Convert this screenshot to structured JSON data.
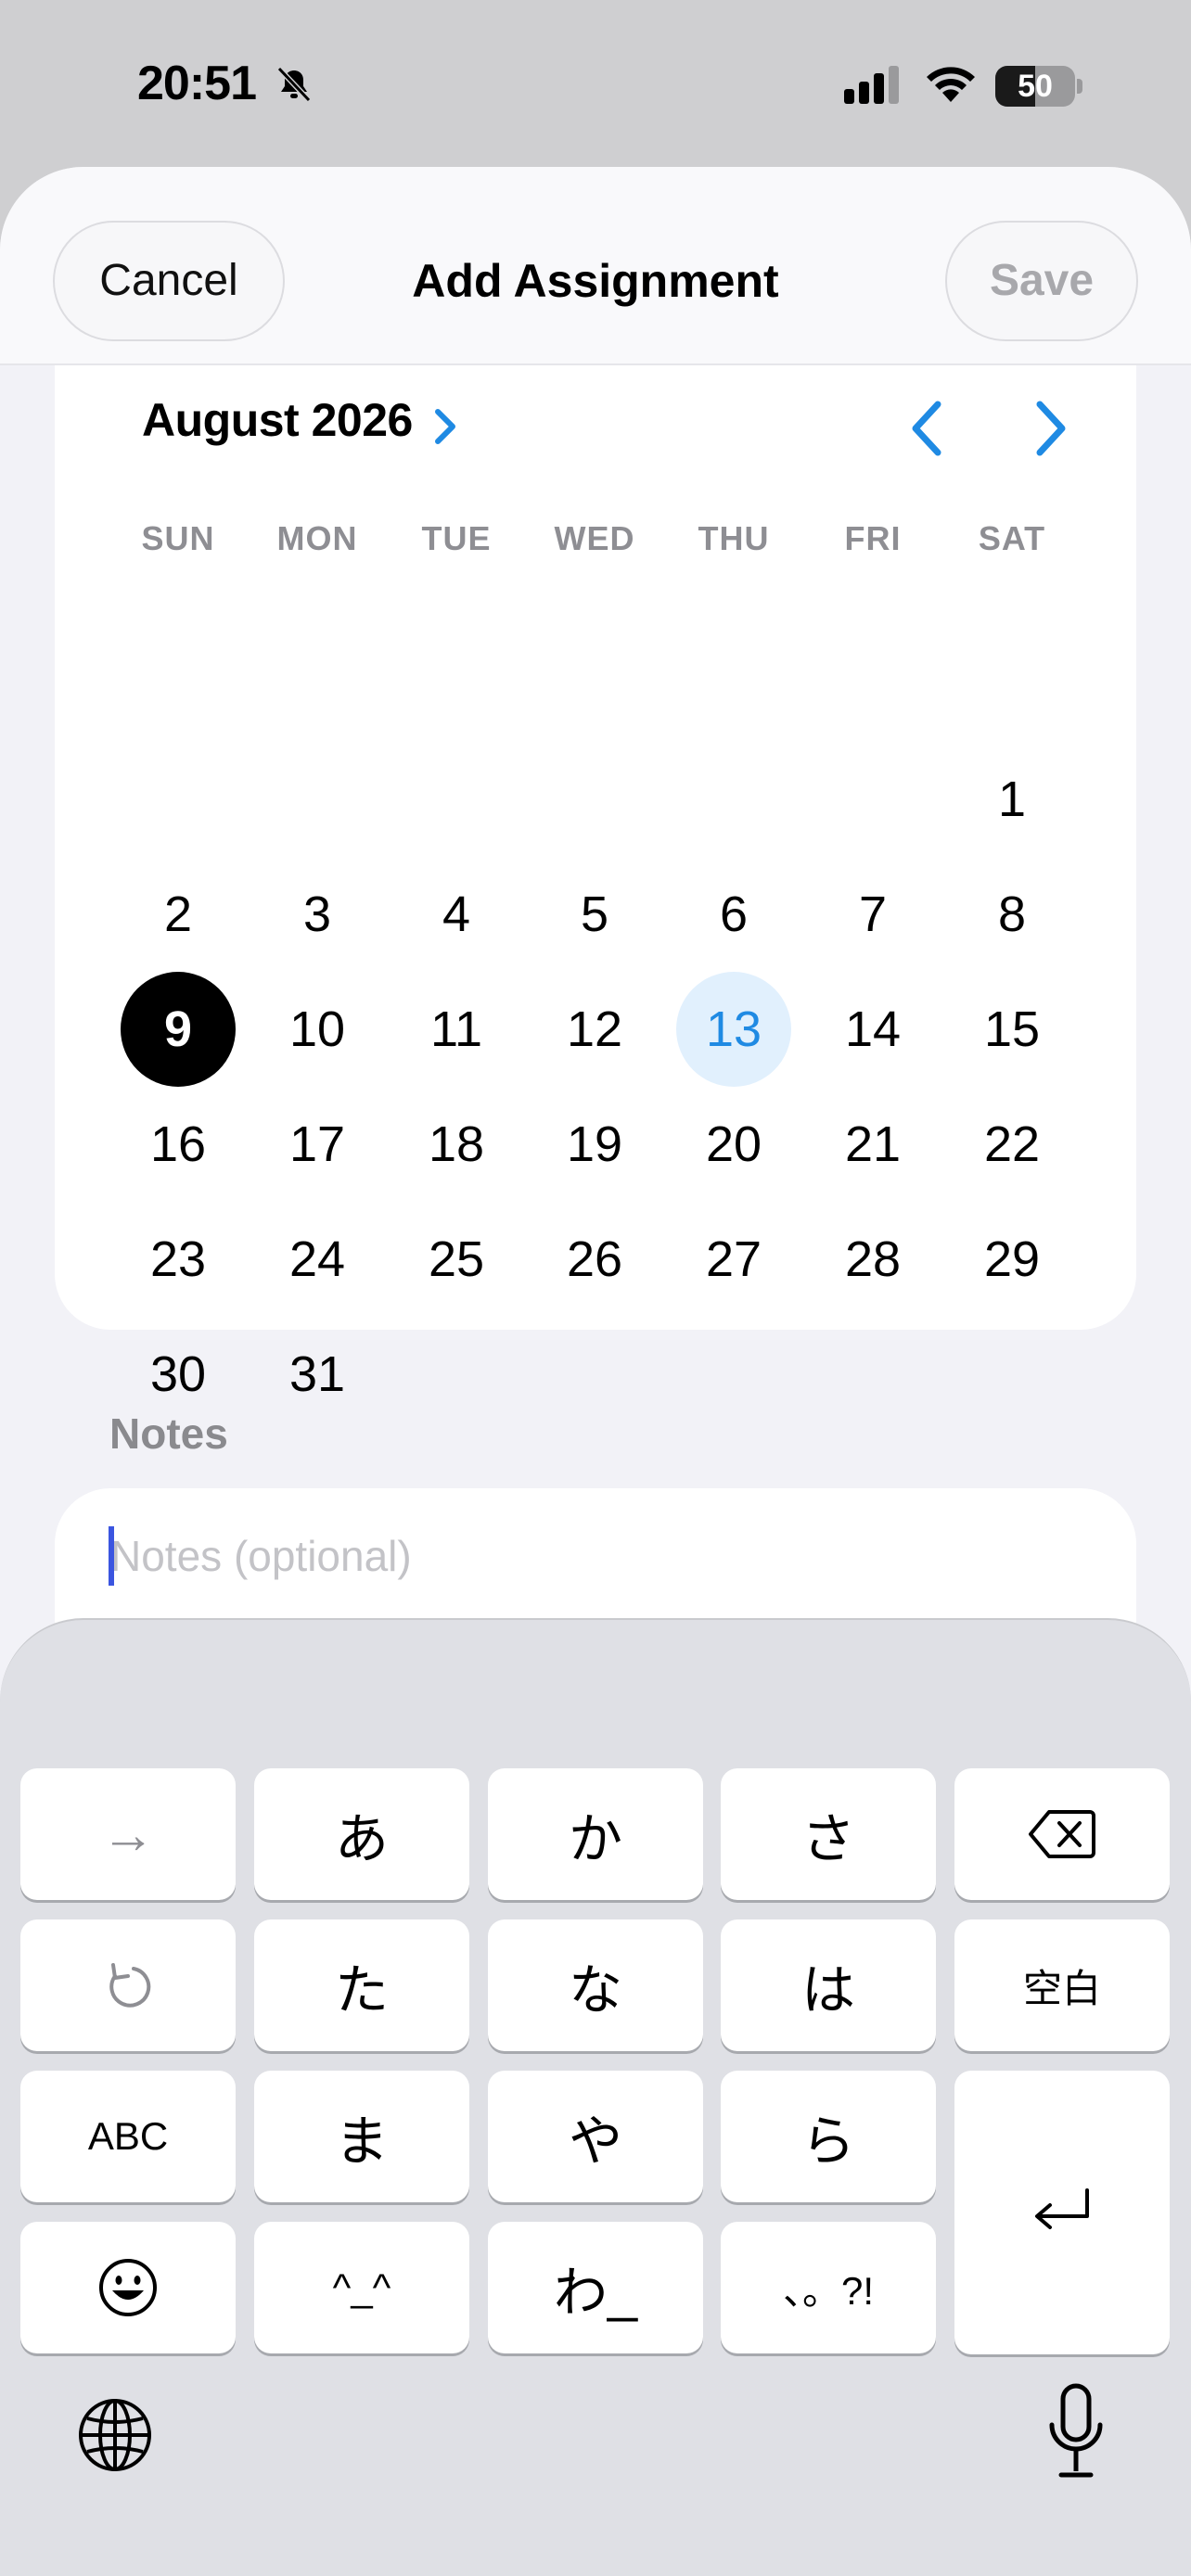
{
  "status_bar": {
    "time": "20:51",
    "battery_percent": "50",
    "battery_level": 0.5,
    "icons": [
      "bell-slash-icon",
      "cellular-signal-icon",
      "wifi-icon",
      "battery-icon"
    ]
  },
  "nav": {
    "cancel_label": "Cancel",
    "title": "Add Assignment",
    "save_label": "Save"
  },
  "calendar": {
    "month_label": "August 2026",
    "month_icon": "chevron-right-icon",
    "prev_icon": "chevron-left-icon",
    "next_icon": "chevron-right-icon",
    "weekdays": [
      "SUN",
      "MON",
      "TUE",
      "WED",
      "THU",
      "FRI",
      "SAT"
    ],
    "first_weekday_index": 6,
    "days": [
      "1",
      "2",
      "3",
      "4",
      "5",
      "6",
      "7",
      "8",
      "9",
      "10",
      "11",
      "12",
      "13",
      "14",
      "15",
      "16",
      "17",
      "18",
      "19",
      "20",
      "21",
      "22",
      "23",
      "24",
      "25",
      "26",
      "27",
      "28",
      "29",
      "30",
      "31"
    ],
    "selected_day": "9",
    "today_day": "13",
    "colors": {
      "accent": "#1f8ae3",
      "today_bg": "#e1f0fd",
      "selected_bg": "#000000"
    }
  },
  "notes": {
    "label": "Notes",
    "placeholder": "Notes (optional)",
    "value": ""
  },
  "keyboard": {
    "keys": [
      [
        "→",
        "あ",
        "か",
        "さ",
        "delete-icon"
      ],
      [
        "undo-icon",
        "た",
        "な",
        "は",
        "空白"
      ],
      [
        "ABC",
        "ま",
        "や",
        "ら",
        "return-icon"
      ],
      [
        "emoji-icon",
        "^_^",
        "わ_",
        "、。?!"
      ]
    ],
    "globe_icon": "globe-icon",
    "mic_icon": "microphone-icon"
  }
}
